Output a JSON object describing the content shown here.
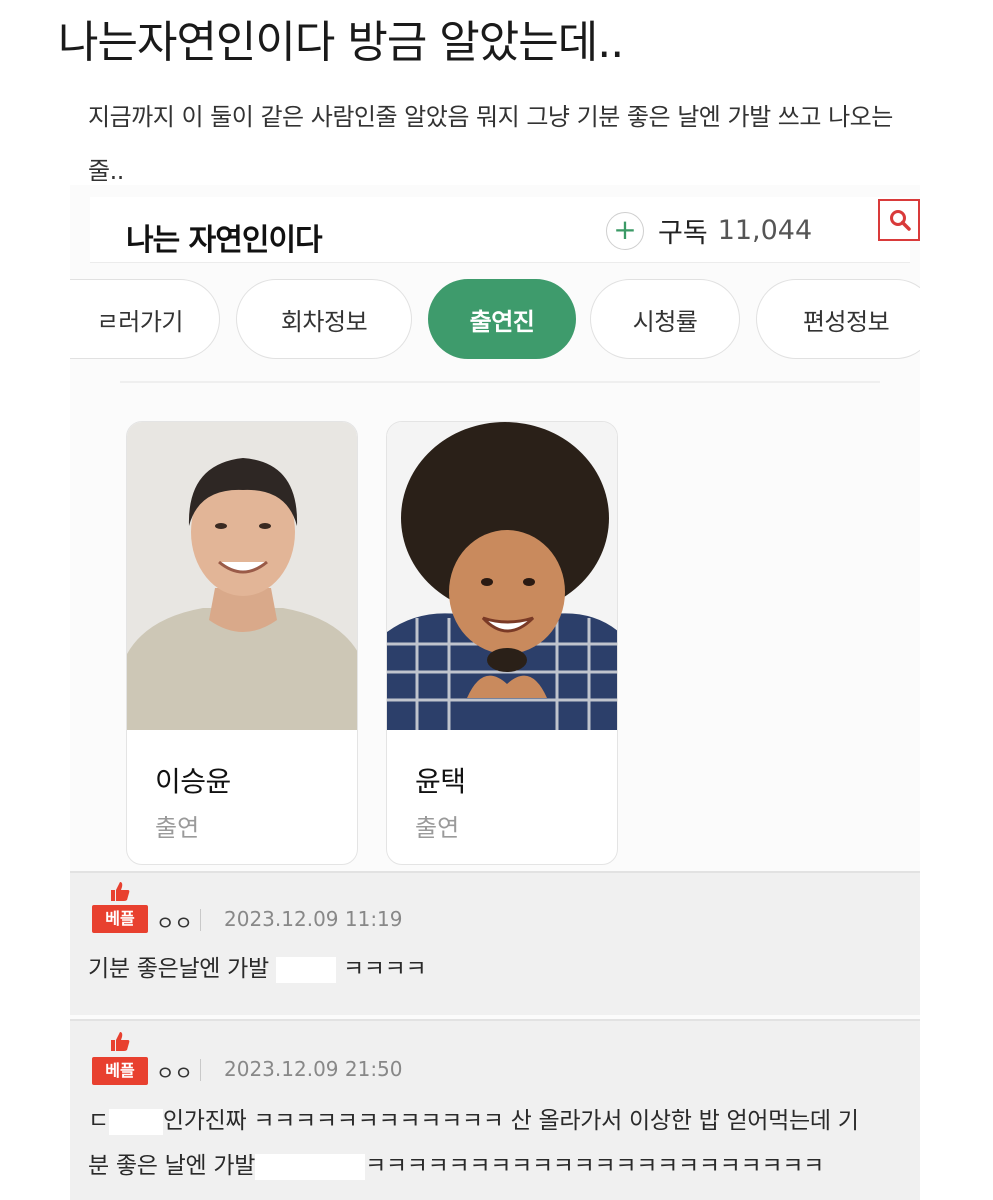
{
  "post": {
    "title": "나는자연인이다 방금 알았는데..",
    "body": "지금까지 이 둘이 같은 사람인줄 알았음 뭐지 그냥 기분 좋은 날엔 가발 쓰고 나오는줄.."
  },
  "program": {
    "title": "나는 자연인이다",
    "subscribe_label": "구독",
    "subscriber_count": "11,044"
  },
  "tabs": [
    {
      "label": "보러가기",
      "visible_label": "ㄹ러가기",
      "active": false
    },
    {
      "label": "회차정보",
      "active": false
    },
    {
      "label": "출연진",
      "active": true
    },
    {
      "label": "시청률",
      "active": false
    },
    {
      "label": "편성정보",
      "active": false
    }
  ],
  "cast": [
    {
      "name": "이승윤",
      "role": "출연"
    },
    {
      "name": "윤택",
      "role": "출연"
    }
  ],
  "comments": [
    {
      "badge": "베플",
      "author": "ㅇㅇ",
      "date": "2023.12.09 11:19",
      "text_before": "기분 좋은날엔 가발 ",
      "text_after": "ㅋㅋㅋㅋ"
    },
    {
      "badge": "베플",
      "author": "ㅇㅇ",
      "date": "2023.12.09 21:50",
      "line1_before": "ㄷ",
      "line1_after": "인가진짜 ㅋㅋㅋㅋㅋㅋㅋㅋㅋㅋㅋㅋ 산 올라가서 이상한 밥 얻어먹는데 기",
      "line2_before": "분 좋은 날엔 가발",
      "line2_after": "ㅋㅋㅋㅋㅋㅋㅋㅋㅋㅋㅋㅋㅋㅋㅋㅋㅋㅋㅋㅋㅋㅋ"
    }
  ],
  "colors": {
    "accent_green": "#3e9b6c",
    "badge_red": "#e8402f",
    "search_red": "#d93a3a"
  },
  "icons": [
    "plus-icon",
    "search-icon",
    "thumbs-up-icon"
  ]
}
